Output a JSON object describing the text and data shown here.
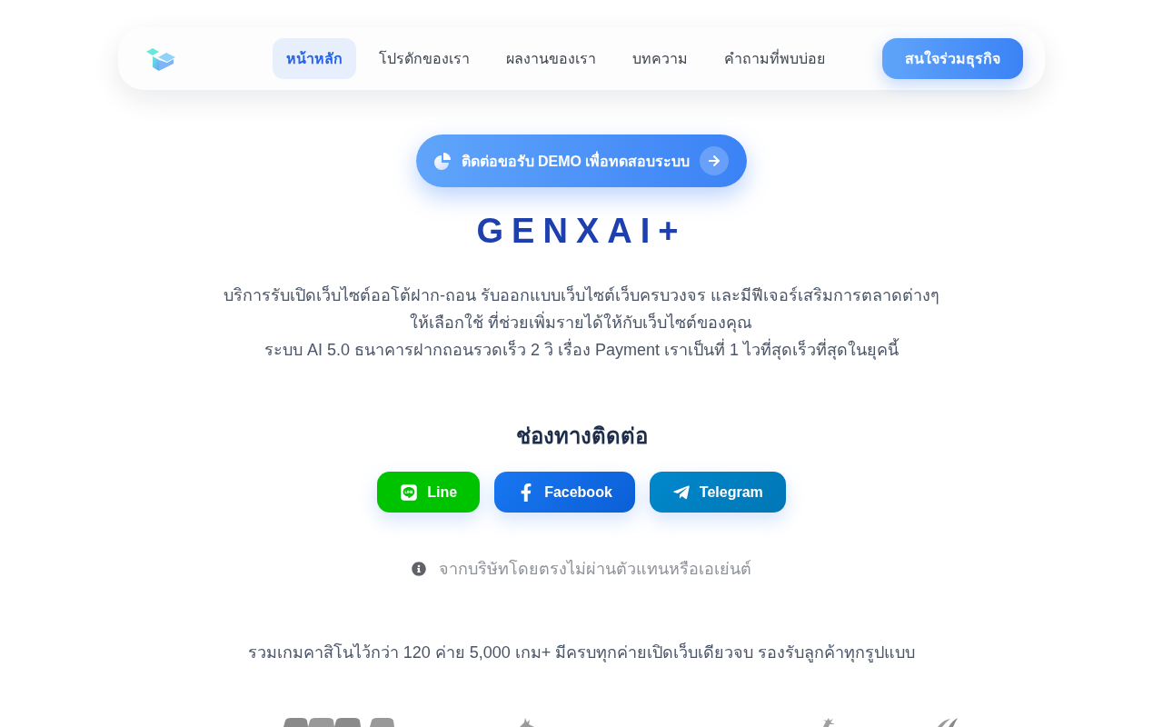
{
  "nav": {
    "items": [
      {
        "label": "หน้าหลัก",
        "selected": true
      },
      {
        "label": "โปรดักของเรา",
        "selected": false
      },
      {
        "label": "ผลงานของเรา",
        "selected": false
      },
      {
        "label": "บทความ",
        "selected": false
      },
      {
        "label": "คำถามที่พบบ่อย",
        "selected": false
      }
    ],
    "cta": "สนใจร่วมธุรกิจ"
  },
  "hero": {
    "demo_button": "ติดต่อขอรับ DEMO เพื่อทดสอบระบบ",
    "brand": "GENXAI+",
    "description": [
      "บริการรับเปิดเว็บไซต์ออโต้ฝาก-ถอน รับออกแบบเว็บไซต์เว็บครบวงจร และมีฟีเจอร์เสริมการตลาดต่างๆ",
      "ให้เลือกใช้ ที่ช่วยเพิ่มรายได้ให้กับเว็บไซต์ของคุณ",
      "ระบบ AI 5.0 ธนาคารฝากถอนรวดเร็ว 2 วิ เรื่อง Payment เราเป็นที่ 1 ไวที่สุดเร็วที่สุดในยุคนี้"
    ]
  },
  "contact": {
    "heading": "ช่องทางติดต่อ",
    "channels": [
      {
        "kind": "line",
        "label": "Line"
      },
      {
        "kind": "facebook",
        "label": "Facebook"
      },
      {
        "kind": "telegram",
        "label": "Telegram"
      }
    ],
    "notice": "จากบริษัทโดยตรงไม่ผ่านตัวแทนหรือเอเย่นต์"
  },
  "games": {
    "headline": "รวมเกมคาสิโนไว้กว่า 120 ค่าย 5,000 เกม+ มีครบทุกค่ายเปิดเว็บเดียวจบ รองรับลูกค้าทุกรูปแบบ"
  }
}
